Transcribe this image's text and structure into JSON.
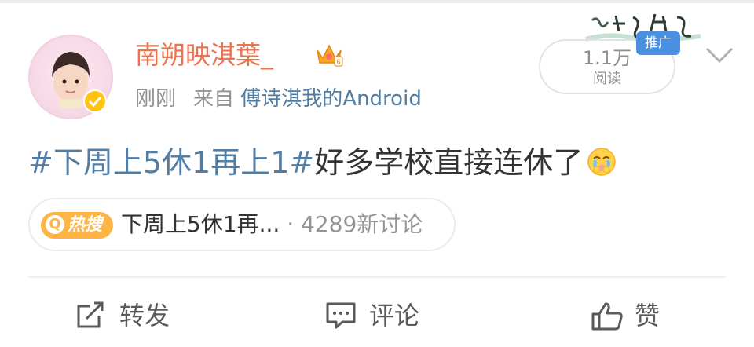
{
  "post": {
    "username": "南朔映淇葉_",
    "time": "刚刚",
    "source_prefix": "来自",
    "source": "傅诗淇我的Android",
    "reads_count": "1.1万",
    "reads_label": "阅读",
    "promo_label": "推广",
    "hashtag": "#下周上5休1再上1#",
    "text": "好多学校直接连休了",
    "emoji": "crying-face"
  },
  "hot_search": {
    "badge_label": "热搜",
    "topic": "下周上5休1再...",
    "count": "· 4289新讨论"
  },
  "actions": {
    "repost_label": "转发",
    "comment_label": "评论",
    "like_label": "赞"
  },
  "colors": {
    "username": "#eb7350",
    "link": "#527da3",
    "muted": "#939393",
    "hot_badge": "#ffb446",
    "verified": "#ffc316",
    "promo": "#4a90e2"
  }
}
